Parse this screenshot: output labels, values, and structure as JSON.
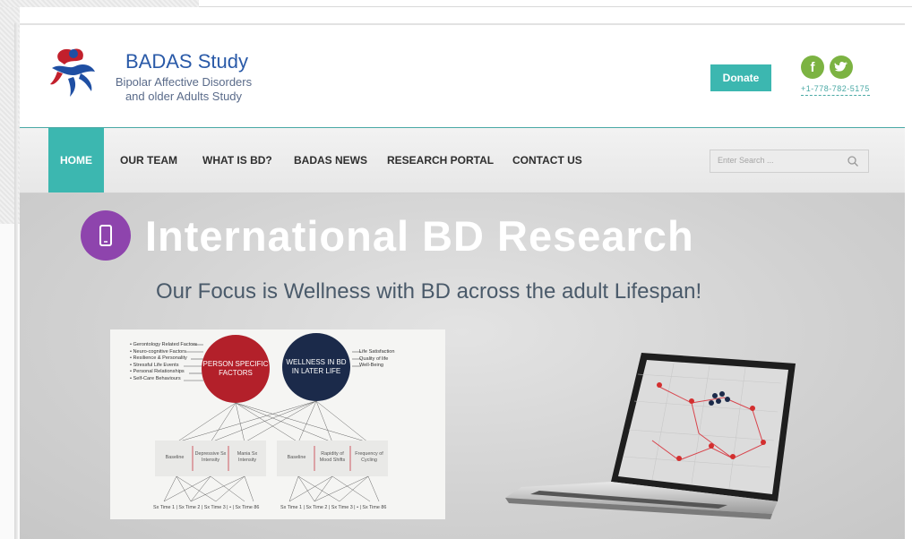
{
  "brand": {
    "title": "BADAS Study",
    "subtitle_line1": "Bipolar Affective Disorders",
    "subtitle_line2": "and older Adults Study"
  },
  "header": {
    "donate_label": "Donate",
    "phone": "+1-778-782-5175",
    "social": [
      {
        "name": "facebook-icon",
        "glyph": "f"
      },
      {
        "name": "twitter-icon",
        "glyph": "t"
      }
    ]
  },
  "nav": {
    "items": [
      {
        "label": "HOME",
        "active": true
      },
      {
        "label": "OUR TEAM"
      },
      {
        "label": "WHAT IS BD?"
      },
      {
        "label": "BADAS NEWS"
      },
      {
        "label": "RESEARCH PORTAL"
      },
      {
        "label": "CONTACT US"
      }
    ],
    "search_placeholder": "Enter Search ..."
  },
  "hero": {
    "title": "International BD Research",
    "subtitle": "Our Focus is Wellness with BD across the adult Lifespan!"
  },
  "diagram": {
    "factors": [
      "• Gerontology Related Factors",
      "• Neuro-cognitive Factors",
      "• Resilience & Personality",
      "• Stressful Life Events",
      "• Personal Relationships",
      "• Self-Care Behaviours"
    ],
    "circle_left_line1": "PERSON SPECIFIC",
    "circle_left_line2": "FACTORS",
    "circle_right_line1": "WELLNESS IN BD",
    "circle_right_line2": "IN LATER LIFE",
    "outcomes": [
      "Life Satisfaction",
      "Quality of life",
      "Well-Being"
    ],
    "boxes_left": [
      "Baseline",
      "Depressive Sx Intensity",
      "Mania Sx Intensity"
    ],
    "boxes_right": [
      "Baseline",
      "Rapidity of Mood Shifts",
      "Frequency of Cycling"
    ],
    "times_left": "Sx Time 1  |  Sx Time 2  |  Sx Time 3  |  •  |  Sx Time 86",
    "times_right": "Sx Time 1  |  Sx Time 2  |  Sx Time 3  |  •  |  Sx Time 86"
  },
  "colors": {
    "teal": "#3cb7b0",
    "brand_blue": "#2a5aa8",
    "purple": "#8e44ad",
    "circle_red": "#b3202a",
    "circle_navy": "#1b2a4a",
    "social_green": "#7cb342"
  }
}
